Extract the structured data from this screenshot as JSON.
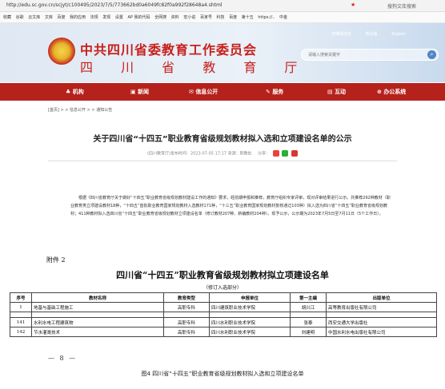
{
  "browser": {
    "url": "http://edu.sc.gov.cn/scjyt/c100495/2023/7/5/773662bd0a6049fc82f0a992f28648a4.shtml",
    "search_right": "搜狗文库搜索"
  },
  "bookmarks": [
    "收藏",
    "谷歌",
    "云文库",
    "文库",
    "百度",
    "我的应用",
    "法规",
    "发现",
    "设置",
    "AP 我的代码",
    "全网搜",
    "资料",
    "宏小说",
    "百家号",
    "科技",
    "百度",
    "第十五",
    "https://..",
    "中金"
  ],
  "header": {
    "org": "中共四川省委教育工作委员会",
    "dept": "四 川 省 教 育 厅",
    "links": [
      "无障碍浏览",
      "移动版",
      "English"
    ],
    "search_placeholder": "请输入搜索关键字",
    "search_icon": "search-icon"
  },
  "nav": {
    "items": [
      "机构",
      "新闻",
      "信息公开",
      "服务",
      "互动",
      "办公系统"
    ]
  },
  "breadcrumb": "[首页] > > 信息公开 > > 通知公告",
  "article": {
    "title": "关于四川省“十四五”职业教育省级规划教材拟入选和立项建设名单的公示",
    "meta": "(四川教育厅)发布时间：2023-07-05 17:17   来源：职教处",
    "share_label": "分享：",
    "body": "根据《四川省教育厅关于做好“十四五”职业教育省级规划教材建设工作的通知》要求，经前期申报和推荐，教育厅组织专家评审，现对评审结果进行公示。共推荐292种教材（职业教育类立项建设教材18种，“十四五”首批职业教育国家规划教材入选教材171种，“十三五”职业教育国家规划教材复核通过103种）拟入选为四川省“十四五”职业教育省级规划教材；411种教材拟入选四川省“十四五”职业教育省级规划教材立项建设名单（修订教材207种、新编教材204种）。现予公示，公示期为2023年7月5日至7月11日（5个工作日）。"
  },
  "doc": {
    "attachment": "附件 2",
    "title": "四川省“十四五”职业教育省级规划教材拟立项建设名单",
    "subtitle": "（修订入选部分）",
    "headers": [
      "序号",
      "教材名称",
      "教育类型",
      "申报单位",
      "第一主编",
      "出版单位"
    ],
    "rows": [
      [
        "1",
        "地基与基础工程施工",
        "高职专科",
        "四川建筑职业技术学院",
        "胡兴江",
        "高等教育出版社有限公司"
      ],
      [
        "141",
        "水利水电工程建筑物",
        "高职专科",
        "四川水利职业技术学院",
        "张泰",
        "西安交通大学出版社"
      ],
      [
        "142",
        "节水灌溉技术",
        "高职专科",
        "四川水利职业技术学院",
        "刘建明",
        "中国水利水电出版社有限公司"
      ]
    ],
    "page": "— 8 —"
  },
  "caption": "图4 四川省“十四五”职业教育省级规划教材拟入选和立项建设名单"
}
